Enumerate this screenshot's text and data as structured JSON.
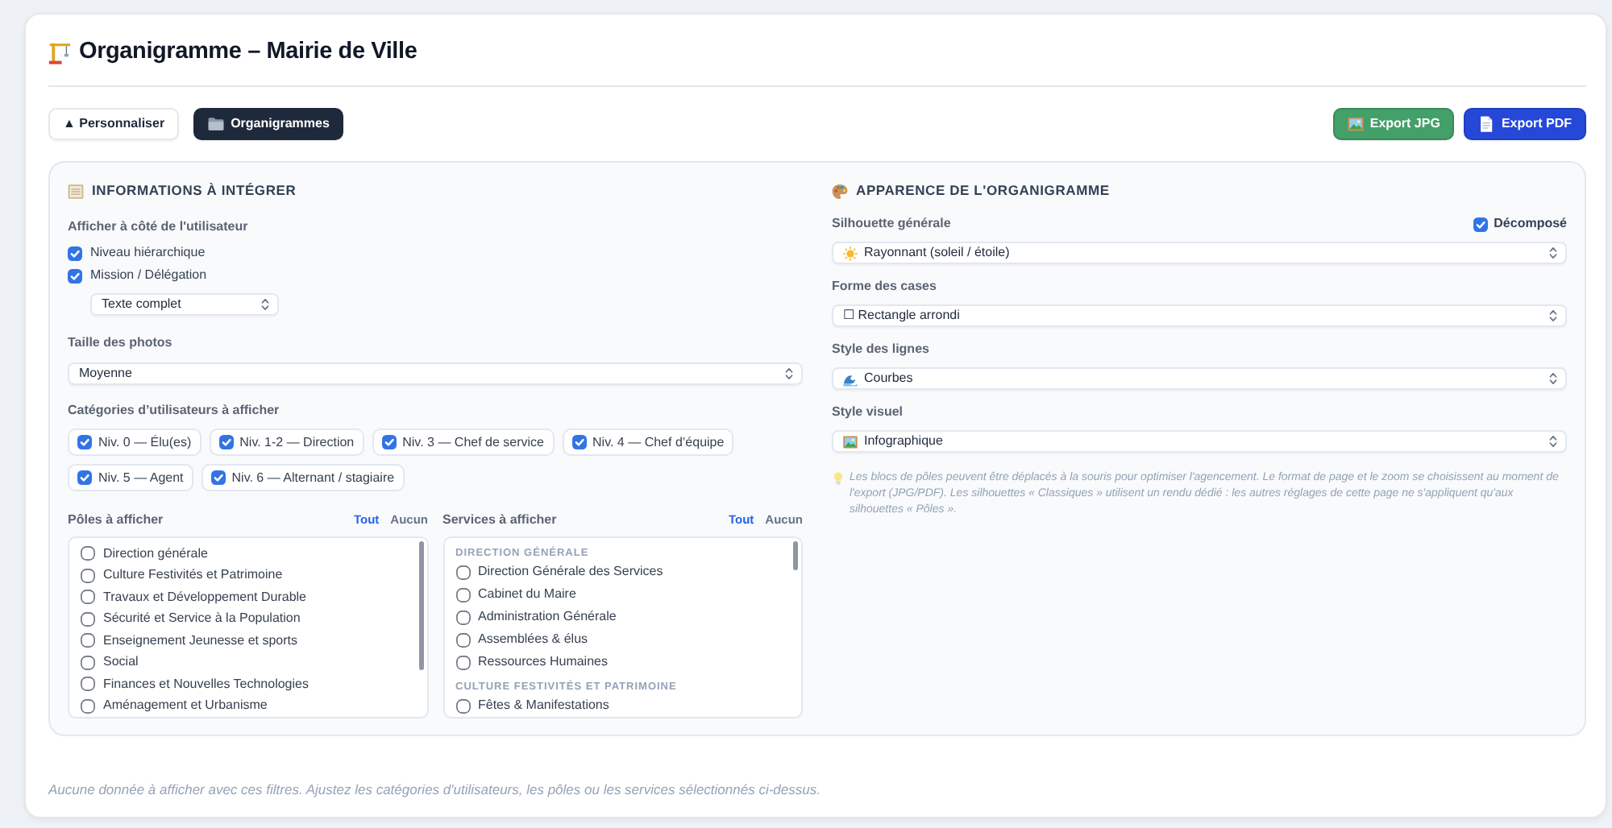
{
  "header": {
    "title": "Organigramme – Mairie de Ville"
  },
  "toolbar": {
    "buttons": [
      {
        "label": "▲ Personnaliser",
        "kind": "outline"
      },
      {
        "label": "Organigrammes",
        "kind": "dark"
      }
    ],
    "exports": [
      {
        "label": "Export JPG",
        "kind": "jpg"
      },
      {
        "label": "Export PDF",
        "kind": "pdf"
      }
    ]
  },
  "info_panel": {
    "title": "INFORMATIONS À INTÉGRER",
    "user_details": {
      "label": "Afficher à côté de l'utilisateur",
      "options": [
        {
          "label": "Niveau hiérarchique",
          "checked": true
        },
        {
          "label": "Mission / Délégation",
          "checked": true
        }
      ],
      "mission_format": "Texte complet"
    },
    "photo_size": {
      "label": "Taille des photos",
      "value": "Moyenne"
    },
    "categories": {
      "label": "Catégories d’utilisateurs à afficher",
      "items": [
        {
          "label": "Niv. 0 — Élu(es)",
          "checked": true
        },
        {
          "label": "Niv. 1-2 — Direction",
          "checked": true
        },
        {
          "label": "Niv. 3 — Chef de service",
          "checked": true
        },
        {
          "label": "Niv. 4 — Chef d’équipe",
          "checked": true
        },
        {
          "label": "Niv. 5 — Agent",
          "checked": true
        },
        {
          "label": "Niv. 6 — Alternant / stagiaire",
          "checked": true
        }
      ]
    },
    "poles": {
      "label": "Pôles à afficher",
      "links": [
        "Tout",
        "Aucun"
      ],
      "items": [
        {
          "label": "Direction générale",
          "checked": false
        },
        {
          "label": "Culture Festivités et Patrimoine",
          "checked": false
        },
        {
          "label": "Travaux et Développement Durable",
          "checked": false
        },
        {
          "label": "Sécurité et Service à la Population",
          "checked": false
        },
        {
          "label": "Enseignement Jeunesse et sports",
          "checked": false
        },
        {
          "label": "Social",
          "checked": false
        },
        {
          "label": "Finances et Nouvelles Technologies",
          "checked": false
        },
        {
          "label": "Aménagement et Urbanisme",
          "checked": false
        }
      ]
    },
    "services": {
      "label": "Services à afficher",
      "links": [
        "Tout",
        "Aucun"
      ],
      "groups": [
        {
          "title": "DIRECTION GÉNÉRALE",
          "items": [
            {
              "label": "Direction Générale des Services",
              "checked": false
            },
            {
              "label": "Cabinet du Maire",
              "checked": false
            },
            {
              "label": "Administration Générale",
              "checked": false
            },
            {
              "label": "Assemblées & élus",
              "checked": false
            },
            {
              "label": "Ressources Humaines",
              "checked": false
            }
          ]
        },
        {
          "title": "CULTURE FESTIVITÉS ET PATRIMOINE",
          "items": [
            {
              "label": "Fêtes & Manifestations",
              "checked": false
            }
          ]
        }
      ]
    }
  },
  "appearance_panel": {
    "title": "APPARENCE DE L'ORGANIGRAMME",
    "decomposed": {
      "label": "Décomposé",
      "checked": true
    },
    "fields": [
      {
        "label": "Silhouette générale",
        "value": "Rayonnant (soleil / étoile)"
      },
      {
        "label": "Forme des cases",
        "value": "☐ Rectangle arrondi"
      },
      {
        "label": "Style des lignes",
        "value": "Courbes"
      },
      {
        "label": "Style visuel",
        "value": "Infographique"
      }
    ],
    "hint": "Les blocs de pôles peuvent être déplacés à la souris pour optimiser l'agencement. Le format de page et le zoom se choisissent au moment de l'export (JPG/PDF). Les silhouettes « Classiques » utilisent un rendu dédié : les autres réglages de cette page ne s'appliquent qu'aux silhouettes « Pôles »."
  },
  "empty_message": "Aucune donnée à afficher avec ces filtres. Ajustez les catégories d'utilisateurs, les pôles ou les services sélectionnés ci-dessus."
}
